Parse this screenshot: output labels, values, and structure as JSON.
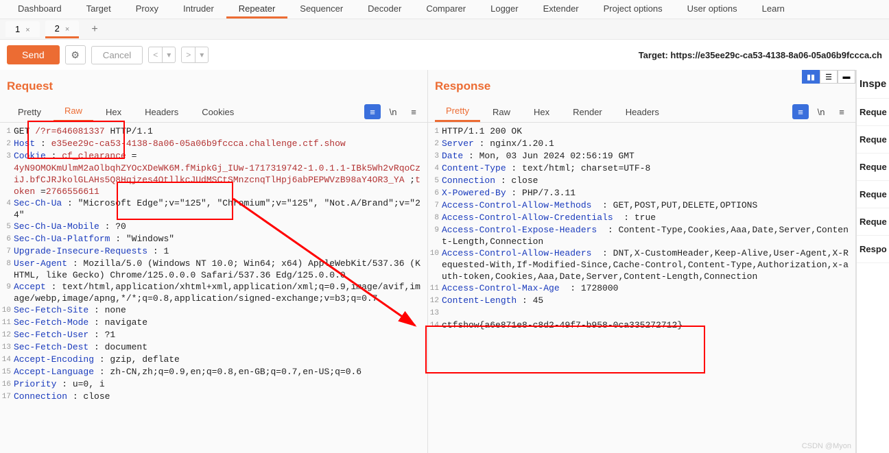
{
  "topTabs": [
    "Dashboard",
    "Target",
    "Proxy",
    "Intruder",
    "Repeater",
    "Sequencer",
    "Decoder",
    "Comparer",
    "Logger",
    "Extender",
    "Project options",
    "User options",
    "Learn"
  ],
  "topTabActive": 4,
  "subTabs": [
    {
      "label": "1",
      "close": "×"
    },
    {
      "label": "2",
      "close": "×"
    }
  ],
  "subTabActive": 1,
  "actions": {
    "send": "Send",
    "cancel": "Cancel",
    "back": "<",
    "backDrop": "▾",
    "fwd": ">",
    "fwdDrop": "▾",
    "gear": "⚙"
  },
  "target": {
    "prefix": "Target: ",
    "url": "https://e35ee29c-ca53-4138-8a06-05a06b9fccca.ch"
  },
  "request": {
    "title": "Request",
    "tabs": [
      "Pretty",
      "Raw",
      "Hex",
      "Headers",
      "Cookies"
    ],
    "activeTab": 1,
    "icons": {
      "act": "≡",
      "newline": "\\n",
      "menu": "≡"
    },
    "lines": [
      {
        "n": "1",
        "parts": [
          {
            "t": "GET "
          },
          {
            "t": "/?r=646081337",
            "c": "red"
          },
          {
            "t": " HTTP/1.1"
          }
        ]
      },
      {
        "n": "2",
        "parts": [
          {
            "t": "Host",
            "c": "hn"
          },
          {
            "t": " : "
          },
          {
            "t": "e35ee29c-ca53-4138-8a06-05a06b9fccca.challenge.ctf.show",
            "c": "red"
          }
        ]
      },
      {
        "n": "3",
        "parts": [
          {
            "t": "Cookie",
            "c": "hn"
          },
          {
            "t": " : "
          },
          {
            "t": "cf_clearance",
            "c": "red"
          },
          {
            "t": " ="
          }
        ]
      },
      {
        "n": "",
        "parts": [
          {
            "t": "4yN9OMOKmUlmM2aOlbqhZYOcXDeWK6M.fMipkGj_IUw-1717319742-1.0.1.1-IBk5Wh2vRqoCziJ.bfCJRJkolGLAHs5Q8Hqjzes4OtllkcJUdMSCtSMnzcnqTlHpj6abPEPWVzB98aY4OR3_YA",
            "c": "red"
          },
          {
            "t": " ;"
          },
          {
            "t": "token",
            "c": "red"
          },
          {
            "t": " ="
          },
          {
            "t": "2766556611",
            "c": "red"
          }
        ]
      },
      {
        "n": "4",
        "parts": [
          {
            "t": "Sec-Ch-Ua",
            "c": "hn"
          },
          {
            "t": " : \"Microsoft Edge\";v=\"125\", \"Chromium\";v=\"125\", \"Not.A/Brand\";v=\"24\""
          }
        ]
      },
      {
        "n": "5",
        "parts": [
          {
            "t": "Sec-Ch-Ua-Mobile",
            "c": "hn"
          },
          {
            "t": " : ?0"
          }
        ]
      },
      {
        "n": "6",
        "parts": [
          {
            "t": "Sec-Ch-Ua-Platform",
            "c": "hn"
          },
          {
            "t": " : \"Windows\""
          }
        ]
      },
      {
        "n": "7",
        "parts": [
          {
            "t": "Upgrade-Insecure-Requests",
            "c": "hn"
          },
          {
            "t": " : 1"
          }
        ]
      },
      {
        "n": "8",
        "parts": [
          {
            "t": "User-Agent",
            "c": "hn"
          },
          {
            "t": " : Mozilla/5.0 (Windows NT 10.0; Win64; x64) AppleWebKit/537.36 (KHTML, like Gecko) Chrome/125.0.0.0 Safari/537.36 Edg/125.0.0.0"
          }
        ]
      },
      {
        "n": "9",
        "parts": [
          {
            "t": "Accept",
            "c": "hn"
          },
          {
            "t": " : text/html,application/xhtml+xml,application/xml;q=0.9,image/avif,image/webp,image/apng,*/*;q=0.8,application/signed-exchange;v=b3;q=0.7"
          }
        ]
      },
      {
        "n": "10",
        "parts": [
          {
            "t": "Sec-Fetch-Site",
            "c": "hn"
          },
          {
            "t": " : none"
          }
        ]
      },
      {
        "n": "11",
        "parts": [
          {
            "t": "Sec-Fetch-Mode",
            "c": "hn"
          },
          {
            "t": " : navigate"
          }
        ]
      },
      {
        "n": "12",
        "parts": [
          {
            "t": "Sec-Fetch-User",
            "c": "hn"
          },
          {
            "t": " : ?1"
          }
        ]
      },
      {
        "n": "13",
        "parts": [
          {
            "t": "Sec-Fetch-Dest",
            "c": "hn"
          },
          {
            "t": " : document"
          }
        ]
      },
      {
        "n": "14",
        "parts": [
          {
            "t": "Accept-Encoding",
            "c": "hn"
          },
          {
            "t": " : gzip, deflate"
          }
        ]
      },
      {
        "n": "15",
        "parts": [
          {
            "t": "Accept-Language",
            "c": "hn"
          },
          {
            "t": " : zh-CN,zh;q=0.9,en;q=0.8,en-GB;q=0.7,en-US;q=0.6"
          }
        ]
      },
      {
        "n": "16",
        "parts": [
          {
            "t": "Priority",
            "c": "hn"
          },
          {
            "t": " : u=0, i"
          }
        ]
      },
      {
        "n": "17",
        "parts": [
          {
            "t": "Connection",
            "c": "hn"
          },
          {
            "t": " : close"
          }
        ]
      }
    ]
  },
  "response": {
    "title": "Response",
    "tabs": [
      "Pretty",
      "Raw",
      "Hex",
      "Render",
      "Headers"
    ],
    "activeTab": 0,
    "icons": {
      "act": "≡",
      "newline": "\\n",
      "menu": "≡"
    },
    "lines": [
      {
        "n": "1",
        "parts": [
          {
            "t": "HTTP/1.1 200 OK"
          }
        ]
      },
      {
        "n": "2",
        "parts": [
          {
            "t": "Server",
            "c": "hn"
          },
          {
            "t": " : nginx/1.20.1"
          }
        ]
      },
      {
        "n": "3",
        "parts": [
          {
            "t": "Date",
            "c": "hn"
          },
          {
            "t": " : Mon, 03 Jun 2024 02:56:19 GMT"
          }
        ]
      },
      {
        "n": "4",
        "parts": [
          {
            "t": "Content-Type",
            "c": "hn"
          },
          {
            "t": " : text/html; charset=UTF-8"
          }
        ]
      },
      {
        "n": "5",
        "parts": [
          {
            "t": "Connection",
            "c": "hn"
          },
          {
            "t": " : close"
          }
        ]
      },
      {
        "n": "6",
        "parts": [
          {
            "t": "X-Powered-By",
            "c": "hn"
          },
          {
            "t": " : PHP/7.3.11"
          }
        ]
      },
      {
        "n": "7",
        "parts": [
          {
            "t": "Access-Control-Allow-Methods",
            "c": "hn"
          },
          {
            "t": "  : GET,POST,PUT,DELETE,OPTIONS"
          }
        ]
      },
      {
        "n": "8",
        "parts": [
          {
            "t": "Access-Control-Allow-Credentials",
            "c": "hn"
          },
          {
            "t": "  : true"
          }
        ]
      },
      {
        "n": "9",
        "parts": [
          {
            "t": "Access-Control-Expose-Headers",
            "c": "hn"
          },
          {
            "t": "  : Content-Type,Cookies,Aaa,Date,Server,Content-Length,Connection"
          }
        ]
      },
      {
        "n": "10",
        "parts": [
          {
            "t": "Access-Control-Allow-Headers",
            "c": "hn"
          },
          {
            "t": "  : DNT,X-CustomHeader,Keep-Alive,User-Agent,X-Requested-With,If-Modified-Since,Cache-Control,Content-Type,Authorization,x-auth-token,Cookies,Aaa,Date,Server,Content-Length,Connection"
          }
        ]
      },
      {
        "n": "11",
        "parts": [
          {
            "t": "Access-Control-Max-Age",
            "c": "hn"
          },
          {
            "t": "  : 1728000"
          }
        ]
      },
      {
        "n": "12",
        "parts": [
          {
            "t": "Content-Length",
            "c": "hn"
          },
          {
            "t": " : 45"
          }
        ]
      },
      {
        "n": "13",
        "parts": [
          {
            "t": " "
          }
        ]
      },
      {
        "n": "14",
        "parts": [
          {
            "t": "ctfshow{a6e871e8-c8d2-49f7-b958-0ca335272712}"
          }
        ]
      }
    ]
  },
  "inspector": {
    "items": [
      "Inspe",
      "Reque",
      "Reque",
      "Reque",
      "Reque",
      "Reque",
      "Respo"
    ]
  },
  "watermark": "CSDN @Myon"
}
